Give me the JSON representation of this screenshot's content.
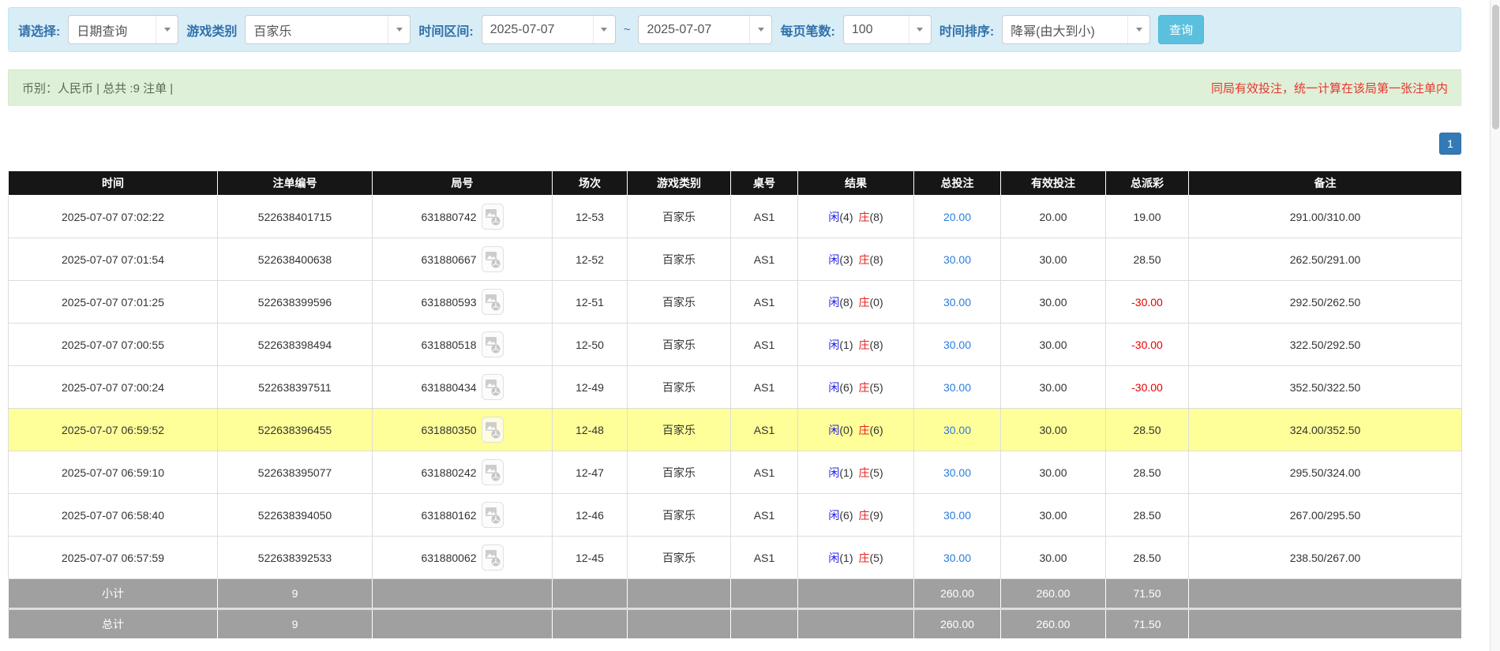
{
  "filter_bar": {
    "select_label": "请选择:",
    "select_value": "日期查询",
    "game_type_label": "游戏类别",
    "game_type_value": "百家乐",
    "time_range_label": "时间区间:",
    "date_from": "2025-07-07",
    "tilde": "~",
    "date_to": "2025-07-07",
    "page_size_label": "每页笔数:",
    "page_size_value": "100",
    "sort_label": "时间排序:",
    "sort_value": "降幂(由大到小)",
    "search_button": "查询"
  },
  "summary_bar": {
    "left_text": "币别：人民币 | 总共 :9 注单 |",
    "right_text": "同局有效投注，统一计算在该局第一张注单内"
  },
  "pagination": {
    "current_page": "1"
  },
  "table": {
    "columns": [
      "时间",
      "注单编号",
      "局号",
      "场次",
      "游戏类别",
      "桌号",
      "结果",
      "总投注",
      "有效投注",
      "总派彩",
      "备注"
    ],
    "rows": [
      {
        "time": "2025-07-07 07:02:22",
        "bet_id": "522638401715",
        "round_id": "631880742",
        "session": "12-53",
        "game": "百家乐",
        "table_no": "AS1",
        "player_label": "闲",
        "player_score": "(4)",
        "banker_label": "庄",
        "banker_score": "(8)",
        "total_bet": "20.00",
        "valid_bet": "20.00",
        "payout": "19.00",
        "remark": "291.00/310.00",
        "highlight": false
      },
      {
        "time": "2025-07-07 07:01:54",
        "bet_id": "522638400638",
        "round_id": "631880667",
        "session": "12-52",
        "game": "百家乐",
        "table_no": "AS1",
        "player_label": "闲",
        "player_score": "(3)",
        "banker_label": "庄",
        "banker_score": "(8)",
        "total_bet": "30.00",
        "valid_bet": "30.00",
        "payout": "28.50",
        "remark": "262.50/291.00",
        "highlight": false
      },
      {
        "time": "2025-07-07 07:01:25",
        "bet_id": "522638399596",
        "round_id": "631880593",
        "session": "12-51",
        "game": "百家乐",
        "table_no": "AS1",
        "player_label": "闲",
        "player_score": "(8)",
        "banker_label": "庄",
        "banker_score": "(0)",
        "total_bet": "30.00",
        "valid_bet": "30.00",
        "payout": "-30.00",
        "remark": "292.50/262.50",
        "highlight": false
      },
      {
        "time": "2025-07-07 07:00:55",
        "bet_id": "522638398494",
        "round_id": "631880518",
        "session": "12-50",
        "game": "百家乐",
        "table_no": "AS1",
        "player_label": "闲",
        "player_score": "(1)",
        "banker_label": "庄",
        "banker_score": "(8)",
        "total_bet": "30.00",
        "valid_bet": "30.00",
        "payout": "-30.00",
        "remark": "322.50/292.50",
        "highlight": false
      },
      {
        "time": "2025-07-07 07:00:24",
        "bet_id": "522638397511",
        "round_id": "631880434",
        "session": "12-49",
        "game": "百家乐",
        "table_no": "AS1",
        "player_label": "闲",
        "player_score": "(6)",
        "banker_label": "庄",
        "banker_score": "(5)",
        "total_bet": "30.00",
        "valid_bet": "30.00",
        "payout": "-30.00",
        "remark": "352.50/322.50",
        "highlight": false
      },
      {
        "time": "2025-07-07 06:59:52",
        "bet_id": "522638396455",
        "round_id": "631880350",
        "session": "12-48",
        "game": "百家乐",
        "table_no": "AS1",
        "player_label": "闲",
        "player_score": "(0)",
        "banker_label": "庄",
        "banker_score": "(6)",
        "total_bet": "30.00",
        "valid_bet": "30.00",
        "payout": "28.50",
        "remark": "324.00/352.50",
        "highlight": true
      },
      {
        "time": "2025-07-07 06:59:10",
        "bet_id": "522638395077",
        "round_id": "631880242",
        "session": "12-47",
        "game": "百家乐",
        "table_no": "AS1",
        "player_label": "闲",
        "player_score": "(1)",
        "banker_label": "庄",
        "banker_score": "(5)",
        "total_bet": "30.00",
        "valid_bet": "30.00",
        "payout": "28.50",
        "remark": "295.50/324.00",
        "highlight": false
      },
      {
        "time": "2025-07-07 06:58:40",
        "bet_id": "522638394050",
        "round_id": "631880162",
        "session": "12-46",
        "game": "百家乐",
        "table_no": "AS1",
        "player_label": "闲",
        "player_score": "(6)",
        "banker_label": "庄",
        "banker_score": "(9)",
        "total_bet": "30.00",
        "valid_bet": "30.00",
        "payout": "28.50",
        "remark": "267.00/295.50",
        "highlight": false
      },
      {
        "time": "2025-07-07 06:57:59",
        "bet_id": "522638392533",
        "round_id": "631880062",
        "session": "12-45",
        "game": "百家乐",
        "table_no": "AS1",
        "player_label": "闲",
        "player_score": "(1)",
        "banker_label": "庄",
        "banker_score": "(5)",
        "total_bet": "30.00",
        "valid_bet": "30.00",
        "payout": "28.50",
        "remark": "238.50/267.00",
        "highlight": false
      }
    ],
    "subtotal": {
      "label": "小计",
      "count": "9",
      "total_bet": "260.00",
      "valid_bet": "260.00",
      "payout": "71.50"
    },
    "total": {
      "label": "总计",
      "count": "9",
      "total_bet": "260.00",
      "valid_bet": "260.00",
      "payout": "71.50"
    }
  },
  "colors": {
    "filter_bar_bg": "#d9edf7",
    "filter_label_blue": "#3071a9",
    "summary_bar_bg": "#dff0d8",
    "summary_note_red": "#e8362d",
    "table_header_bg": "#161616",
    "highlight_row_yellow": "#ffff99",
    "footer_row_gray": "#a0a0a0",
    "bet_link_blue": "#2a7cdf",
    "player_blue": "#2020e8",
    "banker_red": "#e82020",
    "negative_red": "#e60000",
    "search_button_bg": "#5bc0de",
    "pager_blue": "#337ab7"
  }
}
